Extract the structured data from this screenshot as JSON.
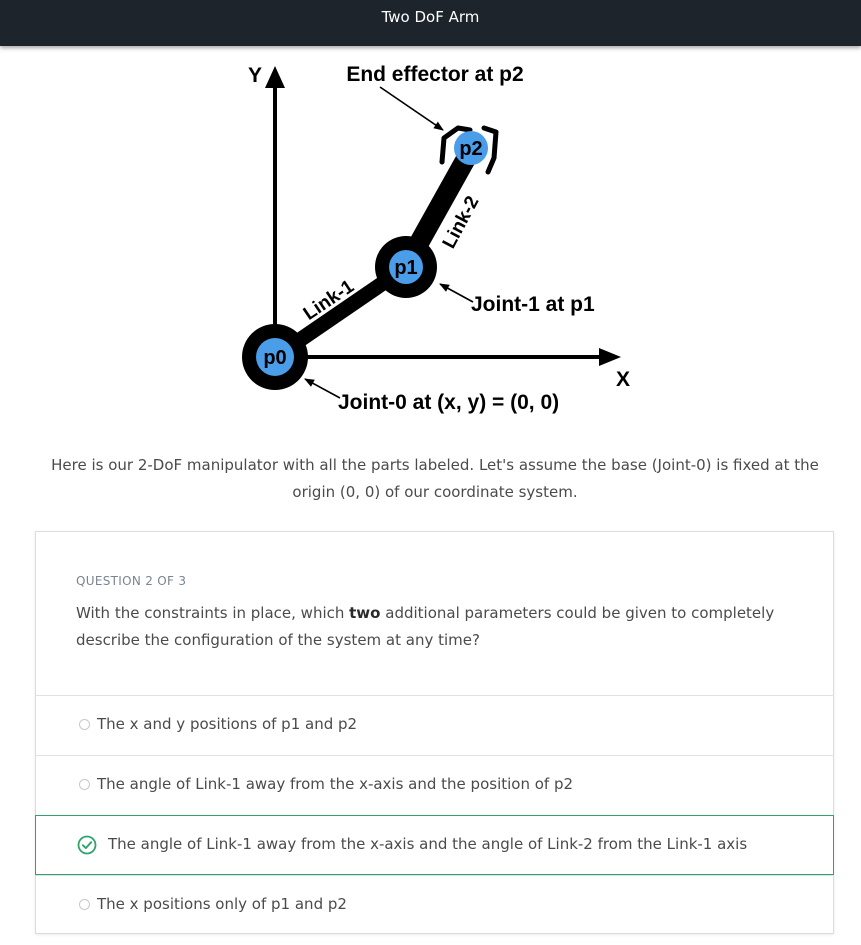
{
  "app": {
    "title": "Two DoF Arm"
  },
  "diagram": {
    "axis_x_label": "X",
    "axis_y_label": "Y",
    "joint_labels": [
      "p0",
      "p1",
      "p2"
    ],
    "link_labels": [
      "Link-1",
      "Link-2"
    ],
    "annotations": {
      "end_effector": "End effector at p2",
      "joint1": "Joint-1 at p1",
      "joint0": "Joint-0 at (x, y) = (0, 0)"
    },
    "colors": {
      "joint_fill": "#4a9de8",
      "ink": "#000000"
    }
  },
  "caption": "Here is our 2-DoF manipulator with all the parts labeled. Let's assume the base (Joint-0) is fixed at the origin (0, 0) of our coordinate system.",
  "quiz": {
    "header": "QUESTION 2 OF 3",
    "question_pre": "With the constraints in place, which ",
    "question_bold": "two",
    "question_post": " additional parameters could be given to completely describe the configuration of the system at any time?",
    "answers": [
      {
        "label": "The x and y positions of p1 and p2",
        "state": "unselected"
      },
      {
        "label": "The angle of Link-1 away from the x-axis and the position of p2",
        "state": "unselected"
      },
      {
        "label": "The angle of Link-1 away from the x-axis and the angle of Link-2 from the Link-1 axis",
        "state": "correct"
      },
      {
        "label": "The x positions only of p1 and p2",
        "state": "unselected"
      }
    ],
    "colors": {
      "correct": "#2fa36b"
    }
  }
}
